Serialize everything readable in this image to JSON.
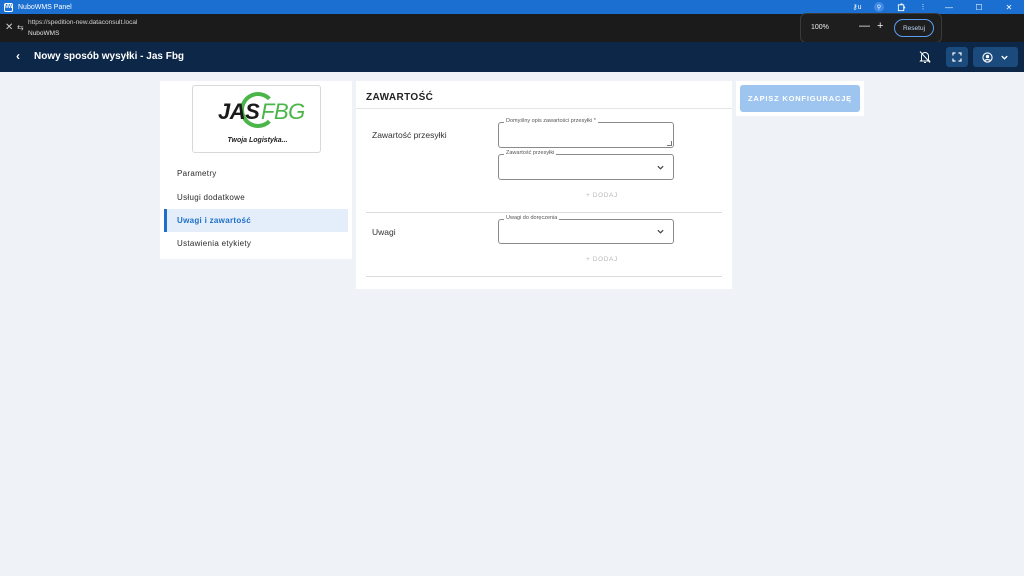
{
  "window": {
    "title": "NuboWMS Panel",
    "app_icon": "NW",
    "tray": {
      "key_icon": "⚷u"
    },
    "controls": {
      "minimize": "—",
      "maximize": "☐",
      "close": "✕"
    }
  },
  "browser": {
    "url": "https://spedition-new.dataconsult.local",
    "site_name": "NuboWMS",
    "zoom": {
      "value": "100%",
      "minus": "—",
      "plus": "+",
      "reset_label": "Resetuj"
    }
  },
  "header": {
    "back_icon": "‹",
    "title": "Nowy sposób wysyłki - Jas Fbg",
    "accent_color": "#0c2747"
  },
  "sidebar": {
    "logo": {
      "part1": "JAS",
      "part2": "FBG",
      "tagline": "Twoja Logistyka..."
    },
    "items": [
      {
        "label": "Parametry"
      },
      {
        "label": "Usługi dodatkowe"
      },
      {
        "label": "Uwagi i zawartość",
        "active": true
      },
      {
        "label": "Ustawienia etykiety"
      }
    ]
  },
  "main": {
    "heading": "ZAWARTOŚĆ",
    "section_contents": {
      "label": "Zawartość przesyłki",
      "default_desc_label": "Domyślny opis zawartości przesyłki *",
      "default_desc_value": "",
      "select_label": "Zawartość przesyłki",
      "select_value": "",
      "add_label": "+ DODAJ"
    },
    "section_notes": {
      "label": "Uwagi",
      "select_label": "Uwagi do doręczenia",
      "select_value": "",
      "add_label": "+ DODAJ"
    }
  },
  "actions": {
    "save_label": "ZAPISZ KONFIGURACJĘ",
    "save_color": "#9ec5ef"
  }
}
